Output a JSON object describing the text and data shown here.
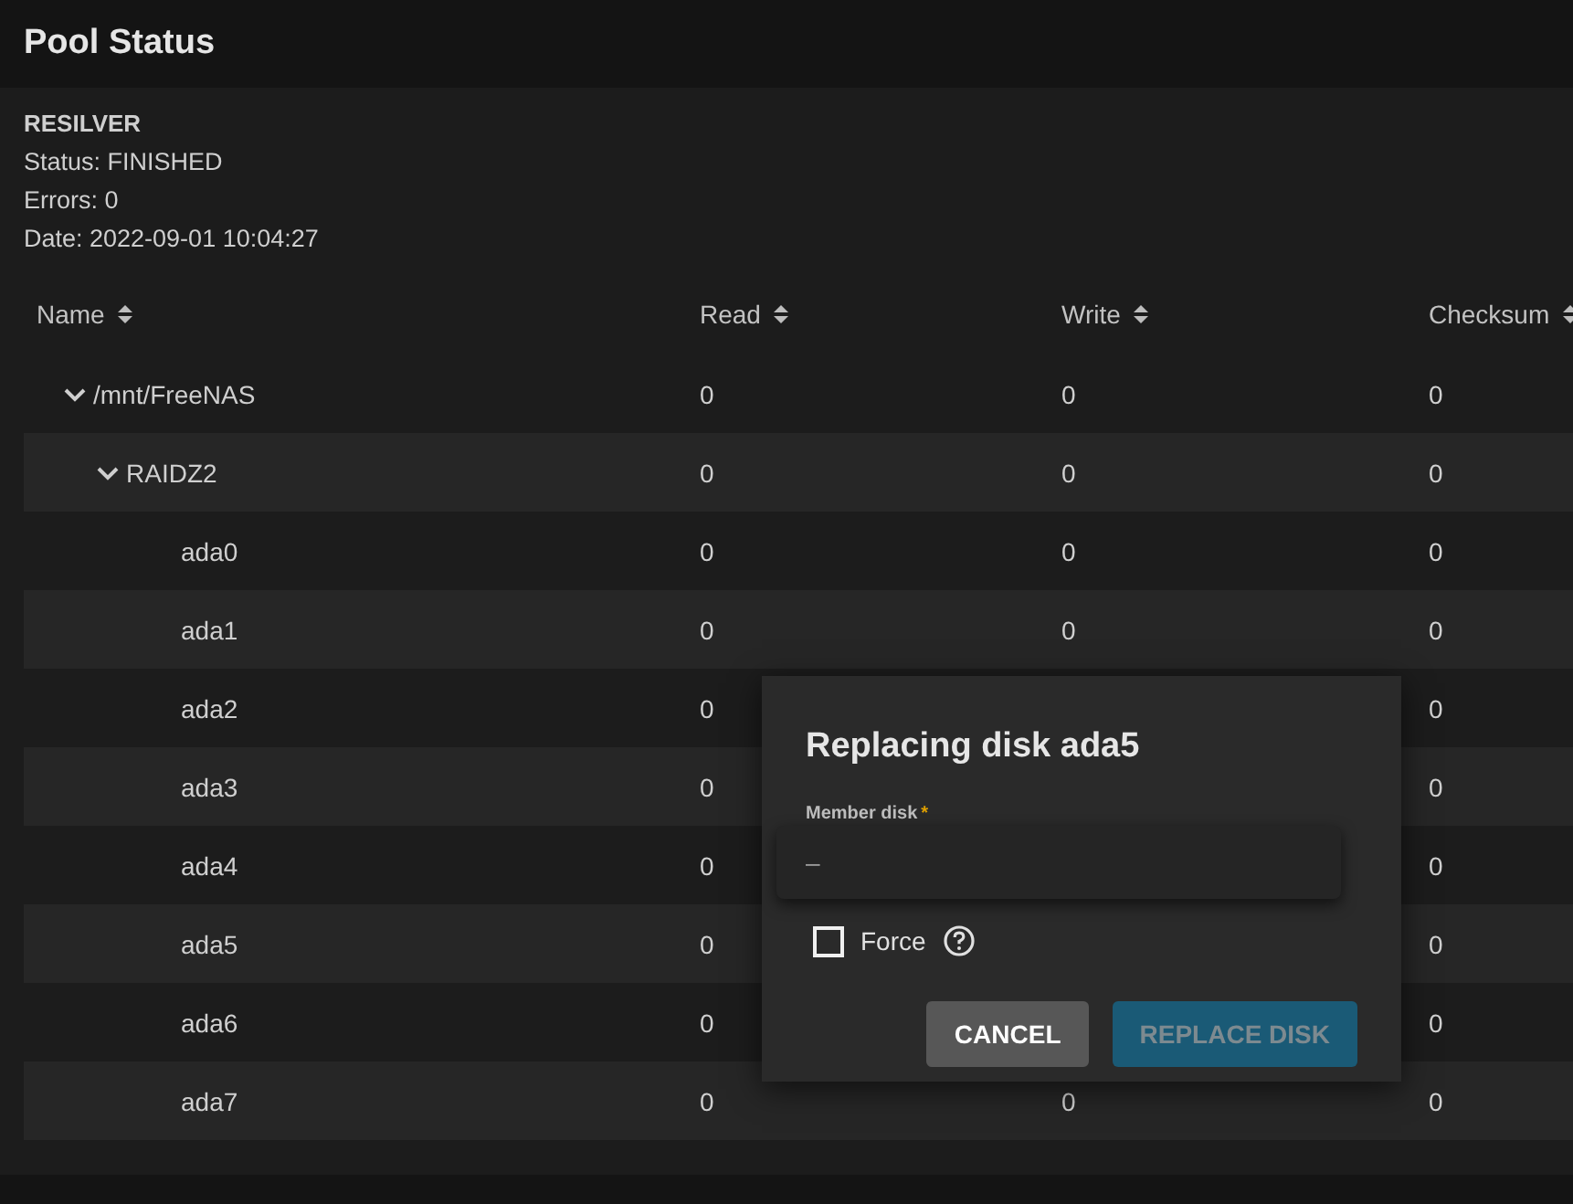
{
  "page_title": "Pool Status",
  "scan": {
    "heading": "RESILVER",
    "lines": [
      "Status: FINISHED",
      "Errors: 0",
      "Date: 2022-09-01 10:04:27"
    ]
  },
  "table": {
    "columns": [
      "Name",
      "Read",
      "Write",
      "Checksum"
    ],
    "rows": [
      {
        "name": "/mnt/FreeNAS",
        "read": "0",
        "write": "0",
        "checksum": "0",
        "expanded": true,
        "children": [
          {
            "name": "RAIDZ2",
            "read": "0",
            "write": "0",
            "checksum": "0",
            "expanded": true,
            "children": [
              {
                "name": "ada0",
                "read": "0",
                "write": "0",
                "checksum": "0"
              },
              {
                "name": "ada1",
                "read": "0",
                "write": "0",
                "checksum": "0"
              },
              {
                "name": "ada2",
                "read": "0",
                "checksum": "0"
              },
              {
                "name": "ada3",
                "read": "0",
                "checksum": "0"
              },
              {
                "name": "ada4",
                "read": "0",
                "checksum": "0"
              },
              {
                "name": "ada5",
                "read": "0",
                "checksum": "0"
              },
              {
                "name": "ada6",
                "read": "0",
                "checksum": "0"
              },
              {
                "name": "ada7",
                "read": "0",
                "write": "0",
                "checksum": "0"
              }
            ]
          }
        ]
      }
    ]
  },
  "dialog": {
    "title": "Replacing disk ada5",
    "field_label": "Member disk",
    "required_mark": "*",
    "dropdown_options": [
      "–"
    ],
    "force": {
      "label": "Force",
      "checked": false
    },
    "buttons": [
      {
        "label": "CANCEL",
        "kind": "secondary"
      },
      {
        "label": "REPLACE DISK",
        "kind": "primary",
        "disabled": true
      }
    ]
  }
}
